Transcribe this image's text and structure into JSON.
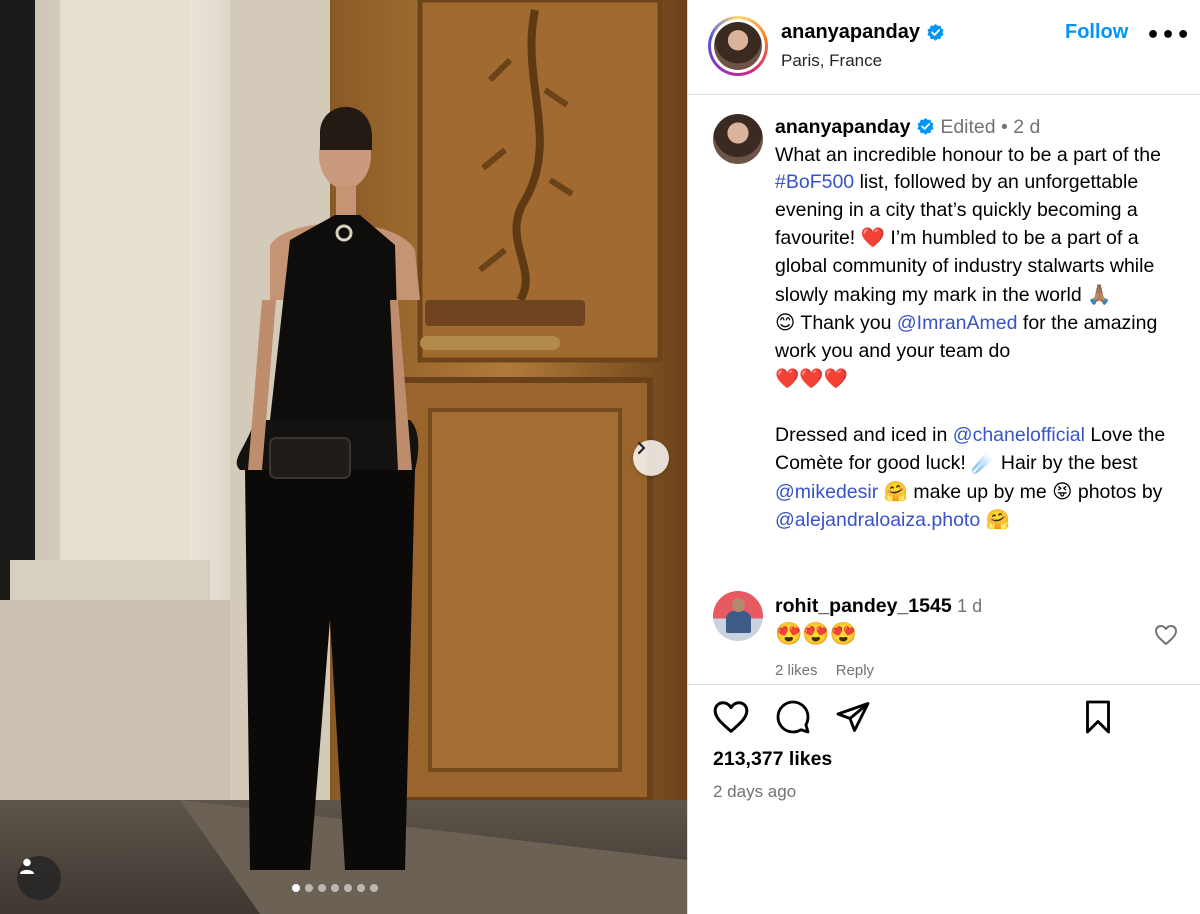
{
  "post": {
    "image_dots": 7,
    "active_dot": 0
  },
  "header": {
    "username": "ananyapanday",
    "location": "Paris, France",
    "follow_label": "Follow",
    "more_label": "•••"
  },
  "caption": {
    "username": "ananyapanday",
    "edited": "Edited",
    "separator": "•",
    "time": "2 d",
    "p1_a": "What an incredible honour to be a part of the ",
    "hashtag": "#BoF500",
    "p1_b": " list, followed by an unforgettable evening in a city that’s quickly becoming a favourite! ",
    "heart": "❤️",
    "p1_c": " I’m humbled to be a part of a global community of industry stalwarts while slowly making my mark in the world ",
    "pray": "🙏🏽",
    "smile": "😊",
    "p1_d": " Thank you ",
    "mention_imran": "@ImranAmed",
    "p1_e": " for the amazing work you and your team do",
    "hearts": "❤️❤️❤️",
    "p2_a": "Dressed and iced in ",
    "mention_chanel": "@chanelofficial",
    "p2_b": " Love the Comète for good luck! ",
    "comet": "☄️",
    "p2_c": " Hair by the best ",
    "mention_mike": "@mikedesir",
    "hug": "🤗",
    "p2_d": " make up by me ",
    "tongue": "😝",
    "p2_e": " photos by ",
    "mention_alejandra": "@alejandraloaiza.photo",
    "hug2": "🤗"
  },
  "comment": {
    "username": "rohit_pandey_1545",
    "time": "1 d",
    "text": "😍😍😍",
    "likes": "2 likes",
    "reply": "Reply"
  },
  "actions": {
    "likes_count": "213,377 likes",
    "time_ago": "2 days ago"
  },
  "icons": {
    "verified": "verified-badge-icon",
    "like": "heart-outline-icon",
    "comment": "comment-bubble-icon",
    "share": "paper-plane-icon",
    "save": "bookmark-icon",
    "next": "chevron-right-icon",
    "tags": "user-tag-icon"
  },
  "colors": {
    "accent_blue": "#0095f6",
    "link_blue": "#3753c7",
    "muted": "#737373",
    "verified_blue": "#0095f6"
  }
}
